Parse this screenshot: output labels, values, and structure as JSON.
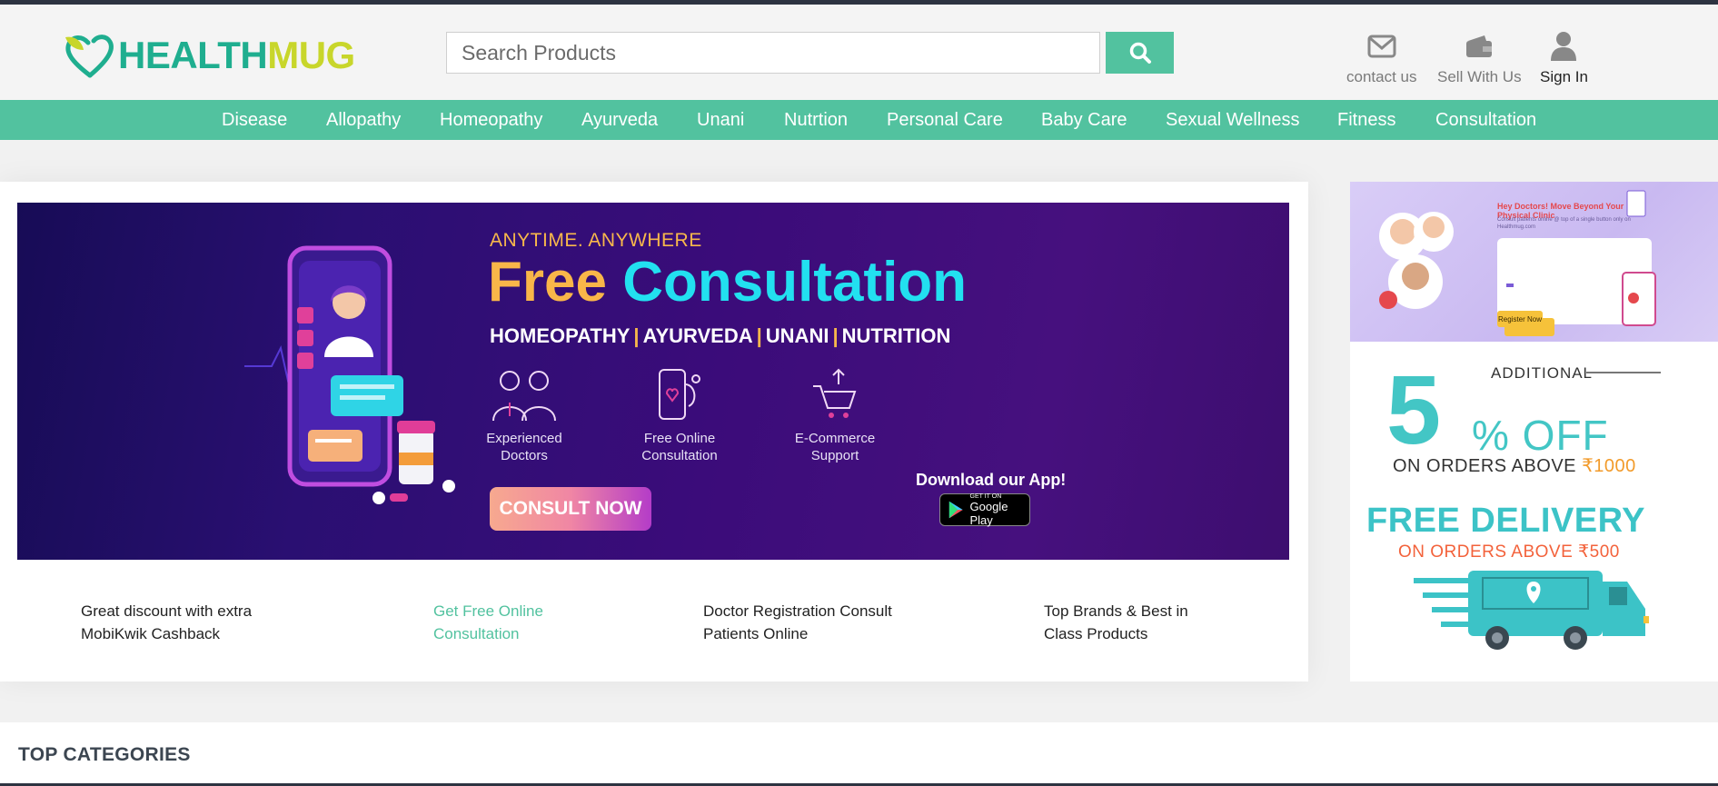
{
  "brand": {
    "logo_part1": "HEALTH",
    "logo_part2": "MUG",
    "accent": "#52c29f",
    "logo_green": "#1fae8f",
    "logo_lime": "#c8d62b"
  },
  "search": {
    "placeholder": "Search Products",
    "value": "",
    "icon": "search-icon"
  },
  "header_links": [
    {
      "label": "contact us",
      "icon": "mail-icon"
    },
    {
      "label": "Sell With Us",
      "icon": "wallet-icon"
    },
    {
      "label": "Sign In",
      "icon": "user-icon"
    }
  ],
  "nav": [
    "Disease",
    "Allopathy",
    "Homeopathy",
    "Ayurveda",
    "Unani",
    "Nutrtion",
    "Personal Care",
    "Baby Care",
    "Sexual Wellness",
    "Fitness",
    "Consultation"
  ],
  "banner": {
    "kicker": "ANYTIME. ANYWHERE",
    "title_part1": "Free",
    "title_part2": "Consultation",
    "systems": [
      "HOMEOPATHY",
      "AYURVEDA",
      "UNANI",
      "NUTRITION"
    ],
    "separator": "|",
    "features": [
      {
        "line1": "Experienced",
        "line2": "Doctors",
        "icon": "doctors-icon"
      },
      {
        "line1": "Free Online",
        "line2": "Consultation",
        "icon": "phone-stethoscope-icon"
      },
      {
        "line1": "E-Commerce",
        "line2": "Support",
        "icon": "cart-icon"
      }
    ],
    "cta": "CONSULT NOW",
    "download": "Download our App!",
    "store_small": "GET IT ON",
    "store_big": "Google Play"
  },
  "highlights": [
    {
      "line1": "Great discount with extra",
      "line2": "MobiKwik Cashback"
    },
    {
      "line1": "Get Free Online",
      "line2": "Consultation"
    },
    {
      "line1": "Doctor Registration Consult",
      "line2": "Patients Online"
    },
    {
      "line1": "Top Brands & Best in",
      "line2": "Class Products"
    }
  ],
  "promo": {
    "top": {
      "heading": "Hey Doctors! Move Beyond Your Physical Clinic",
      "sub": "Consult patients online @ top of a single button only on Healthmug.com",
      "button": "Register Now"
    },
    "additional": "ADDITIONAL",
    "percent": "5",
    "off": "% OFF",
    "above_text": "ON ORDERS ABOVE ",
    "above_amount": "₹1000",
    "free_delivery": "FREE DELIVERY",
    "delivery_condition": "ON ORDERS ABOVE ₹500"
  },
  "top_categories": {
    "title": "TOP CATEGORIES"
  }
}
